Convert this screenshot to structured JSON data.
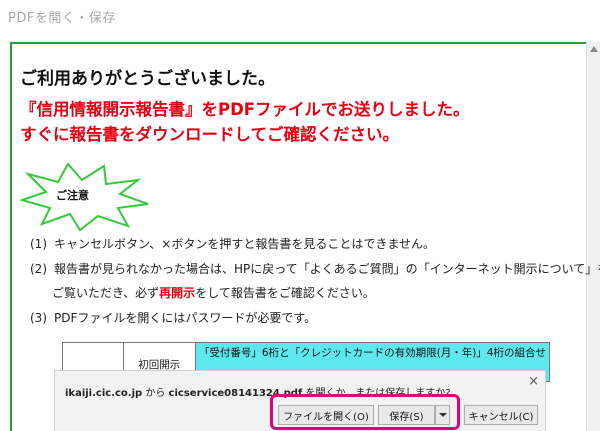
{
  "window": {
    "title": "PDFを開く・保存"
  },
  "main": {
    "thanks": "ご利用ありがとうございました。",
    "message_line1": "『信用情報開示報告書』をPDFファイルでお送りしました。",
    "message_line2": "すぐに報告書をダウンロードしてご確認ください。",
    "notice_label": "ご注意",
    "notes": [
      {
        "num": "(1)",
        "text": "キャンセルボタン、×ボタンを押すと報告書を見ることはできません。"
      },
      {
        "num": "(2)",
        "text": "報告書が見られなかった場合は、HPに戻って「よくあるご質問」の「インターネット開示について」を"
      },
      {
        "text_before": "ご覧いただき、必ず",
        "emphasis": "再開示",
        "text_after": "をして報告書をご確認ください。"
      },
      {
        "num": "(3)",
        "text": "PDFファイルを開くにはパスワードが必要です。"
      }
    ],
    "table": {
      "cell2": "初回開示",
      "cell3": "「受付番号」6桁と「クレジットカードの有効期限(月・年)」4桁の組合せ"
    }
  },
  "download_bar": {
    "host": "ikaiji.cic.co.jp",
    "from_text": " から ",
    "file": "cicservice08141324.pdf",
    "question": " を開くか、または保存しますか?",
    "open_label": "ファイルを開く(O)",
    "save_label": "保存(S)",
    "cancel_label": "キャンセル(C)",
    "close_symbol": "×"
  },
  "colors": {
    "accent_red": "#e60012",
    "frame_green": "#2e9b3a",
    "highlight": "#e2007a",
    "table_cyan": "#5ce8ec"
  }
}
